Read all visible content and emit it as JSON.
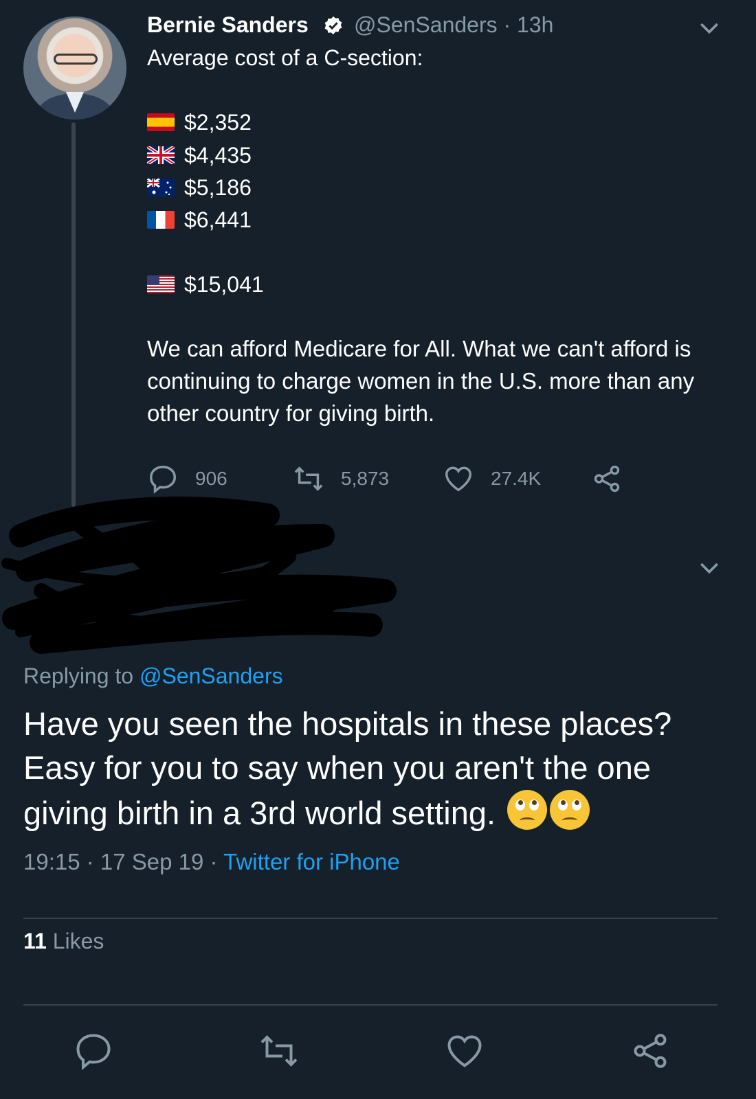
{
  "original_tweet": {
    "author_name": "Bernie Sanders",
    "handle": "@SenSanders",
    "time": "· 13h",
    "intro": "Average cost of a C-section:",
    "costs": [
      {
        "country": "spain",
        "amount": "$2,352"
      },
      {
        "country": "united-kingdom",
        "amount": "$4,435"
      },
      {
        "country": "australia",
        "amount": "$5,186"
      },
      {
        "country": "france",
        "amount": "$6,441"
      },
      {
        "country": "united-states",
        "amount": "$15,041"
      }
    ],
    "body": "We can afford Medicare for All. What we can't afford is continuing to charge women in the U.S. more than any other country for giving birth.",
    "replies": "906",
    "retweets": "5,873",
    "likes": "27.4K"
  },
  "reply": {
    "replying_prefix": "Replying to",
    "replying_handle": "@SenSanders",
    "text": "Have you seen the hospitals in these places? Easy for you to say when you  aren't the one giving birth in a 3rd world setting.",
    "emojis": [
      "face-with-rolling-eyes",
      "face-with-rolling-eyes"
    ],
    "timestamp": "19:15 · 17 Sep 19 ·",
    "source": "Twitter for iPhone",
    "likes_count": "11",
    "likes_label": "Likes"
  },
  "icons": {
    "reply": "reply-icon",
    "retweet": "retweet-icon",
    "like": "heart-icon",
    "share": "share-icon",
    "more": "chevron-down-icon",
    "verified": "verified-badge-icon"
  },
  "colors": {
    "background": "#15202b",
    "muted": "#8899a6",
    "link": "#1da1f2",
    "divider": "#38444d"
  }
}
